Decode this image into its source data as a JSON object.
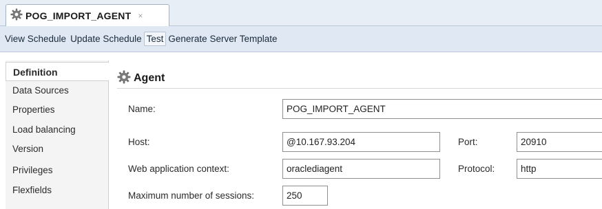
{
  "tab": {
    "title": "POG_IMPORT_AGENT",
    "close": "×"
  },
  "toolbar": {
    "items": [
      "View Schedule",
      "Update Schedule",
      "Test",
      "Generate Server Template"
    ],
    "active": "Test"
  },
  "nav": {
    "items": [
      "Definition",
      "Data Sources",
      "Properties",
      "Load balancing",
      "Version",
      "Privileges",
      "Flexfields"
    ],
    "selected": "Definition"
  },
  "section": {
    "title": "Agent",
    "icon": "gear-icon",
    "fields": {
      "name": {
        "label": "Name:",
        "value": "POG_IMPORT_AGENT"
      },
      "host": {
        "label": "Host:",
        "value": "@10.167.93.204"
      },
      "port": {
        "label": "Port:",
        "value": "20910"
      },
      "context": {
        "label": "Web application context:",
        "value": "oraclediagent"
      },
      "protocol": {
        "label": "Protocol:",
        "value": "http"
      },
      "sessions": {
        "label": "Maximum number of sessions:",
        "value": "250"
      }
    }
  },
  "colors": {
    "tab_bg": "#e8eef6",
    "toolbar_bg": "#dfe8f3",
    "nav_bg": "#f4f4f4"
  }
}
